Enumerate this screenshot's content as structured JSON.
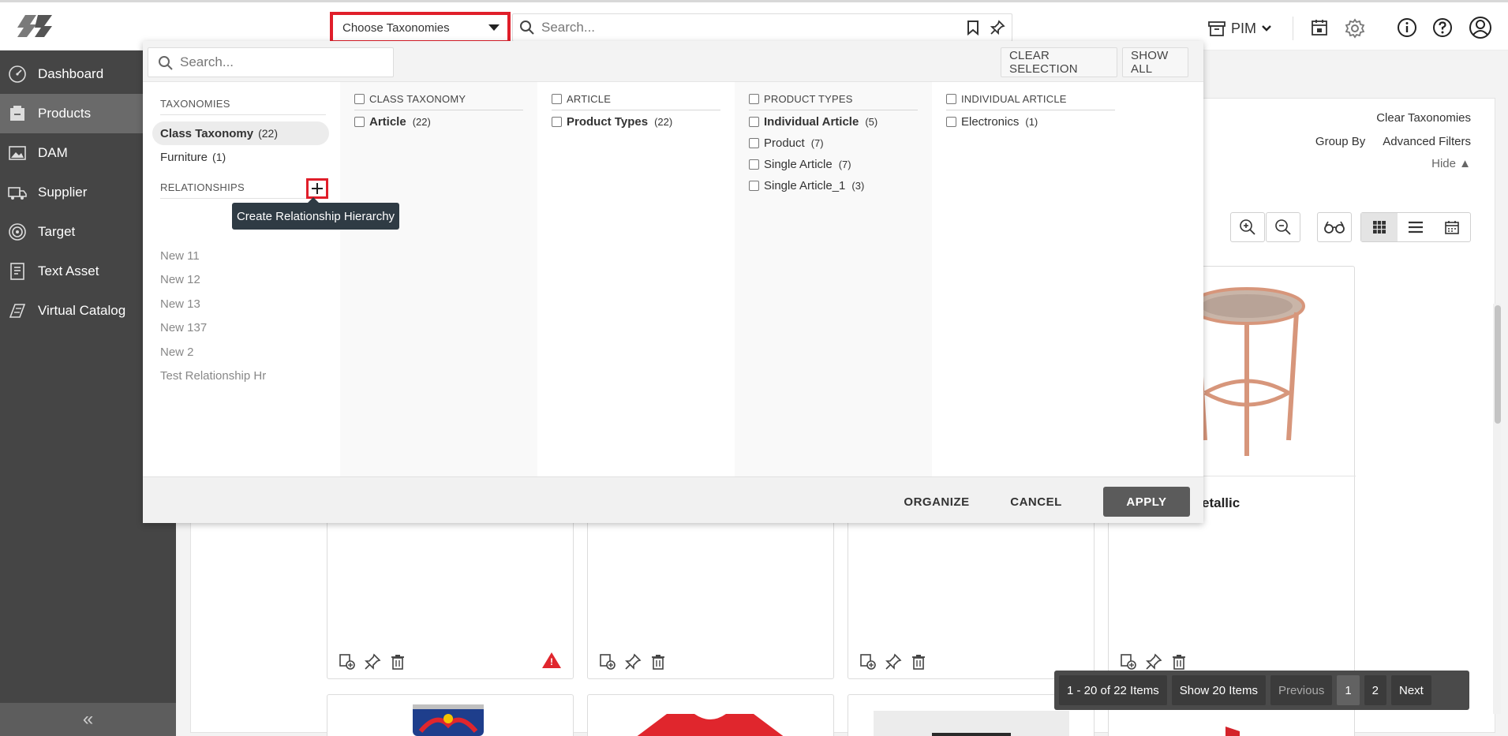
{
  "header": {
    "logo_icon": "brand-logo-icon",
    "taxonomy_select": {
      "label": "Choose Taxonomies"
    },
    "search": {
      "placeholder": "Search..."
    },
    "switcher": {
      "label": "PIM"
    }
  },
  "sidebar": {
    "items": [
      {
        "label": "Dashboard",
        "icon": "dashboard-icon"
      },
      {
        "label": "Products",
        "icon": "products-icon"
      },
      {
        "label": "DAM",
        "icon": "image-icon"
      },
      {
        "label": "Supplier",
        "icon": "truck-icon"
      },
      {
        "label": "Target",
        "icon": "target-icon"
      },
      {
        "label": "Text Asset",
        "icon": "document-icon"
      },
      {
        "label": "Virtual Catalog",
        "icon": "catalog-icon"
      }
    ],
    "active": "Products",
    "collapse_label": "«"
  },
  "content": {
    "clear_taxonomies": "Clear Taxonomies",
    "group_by": "Group By",
    "advanced_filters": "Advanced Filters",
    "hide": "Hide ▲",
    "visible_card_title_fragment": "etallic",
    "warning_badge": "!"
  },
  "taxonomy_panel": {
    "search_placeholder": "Search...",
    "clear_selection": "CLEAR SELECTION",
    "show_all": "SHOW ALL",
    "taxonomies_label": "TAXONOMIES",
    "taxonomies": [
      {
        "name": "Class Taxonomy",
        "count": "(22)",
        "selected": true
      },
      {
        "name": "Furniture",
        "count": "(1)",
        "selected": false
      }
    ],
    "relationships_label": "RELATIONSHIPS",
    "relationships": [
      "New 11",
      "New 12",
      "New 13",
      "New 137",
      "New 2",
      "Test Relationship Hr"
    ],
    "tooltip": "Create Relationship Hierarchy",
    "columns": [
      {
        "header": "CLASS TAXONOMY",
        "rows": [
          {
            "name": "Article",
            "count": "(22)",
            "bold": true
          }
        ]
      },
      {
        "header": "ARTICLE",
        "rows": [
          {
            "name": "Product Types",
            "count": "(22)",
            "bold": true
          }
        ]
      },
      {
        "header": "PRODUCT TYPES",
        "rows": [
          {
            "name": "Individual Article",
            "count": "(5)",
            "bold": true
          },
          {
            "name": "Product",
            "count": "(7)",
            "bold": false
          },
          {
            "name": "Single Article",
            "count": "(7)",
            "bold": false
          },
          {
            "name": "Single Article_1",
            "count": "(3)",
            "bold": false
          }
        ]
      },
      {
        "header": "INDIVIDUAL ARTICLE",
        "rows": [
          {
            "name": "Electronics",
            "count": "(1)",
            "bold": false
          }
        ]
      }
    ],
    "footer": {
      "organize": "ORGANIZE",
      "cancel": "CANCEL",
      "apply": "APPLY"
    }
  },
  "pagination": {
    "summary": "1 - 20 of 22 Items",
    "page_size": "Show 20 Items",
    "previous": "Previous",
    "pages": [
      "1",
      "2"
    ],
    "current": "1",
    "next": "Next"
  },
  "colors": {
    "highlight_red": "#e01e2a",
    "sidebar_bg": "#454545",
    "tooltip_bg": "#2f3b44"
  }
}
